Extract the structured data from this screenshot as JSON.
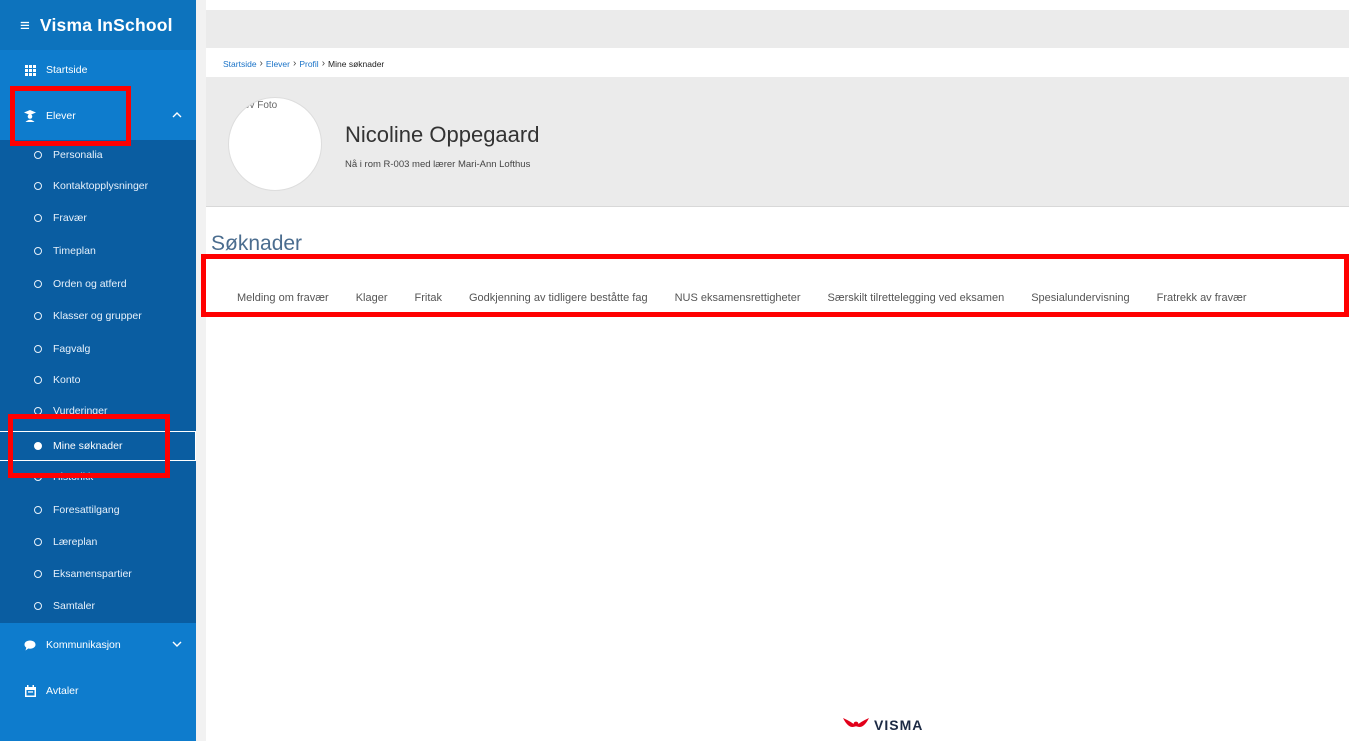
{
  "app": {
    "title": "Visma InSchool"
  },
  "sidebar": {
    "startside": "Startside",
    "elever": "Elever",
    "sub_items": [
      {
        "label": "Personalia",
        "active": false
      },
      {
        "label": "Kontaktopplysninger",
        "active": false
      },
      {
        "label": "Fravær",
        "active": false
      },
      {
        "label": "Timeplan",
        "active": false
      },
      {
        "label": "Orden og atferd",
        "active": false
      },
      {
        "label": "Klasser og grupper",
        "active": false
      },
      {
        "label": "Fagvalg",
        "active": false
      },
      {
        "label": "Konto",
        "active": false
      },
      {
        "label": "Vurderinger",
        "active": false
      },
      {
        "label": "Mine søknader",
        "active": true
      },
      {
        "label": "Historikk",
        "active": false
      },
      {
        "label": "Foresattilgang",
        "active": false
      },
      {
        "label": "Læreplan",
        "active": false
      },
      {
        "label": "Eksamenspartier",
        "active": false
      },
      {
        "label": "Samtaler",
        "active": false
      }
    ],
    "kommunikasjon": "Kommunikasjon",
    "avtaler": "Avtaler"
  },
  "breadcrumb": {
    "items": [
      "Startside",
      "Elever",
      "Profil"
    ],
    "current": "Mine søknader"
  },
  "profile": {
    "photo_alt": "Elev Foto",
    "name": "Nicoline Oppegaard",
    "subtitle": "Nå i rom R-003 med lærer Mari-Ann Lofthus"
  },
  "section": {
    "title": "Søknader",
    "tabs": [
      "Melding om fravær",
      "Klager",
      "Fritak",
      "Godkjenning av tidligere beståtte fag",
      "NUS eksamensrettigheter",
      "Særskilt tilrettelegging ved eksamen",
      "Spesialundervisning",
      "Fratrekk av fravær"
    ]
  },
  "footer": {
    "brand": "VISMA"
  },
  "colors": {
    "sidebar": "#0e7ccd",
    "sidebar_sub": "#0a5da1",
    "highlight": "#ff0000",
    "section_title": "#4b6d8f",
    "link": "#1a73c8"
  }
}
